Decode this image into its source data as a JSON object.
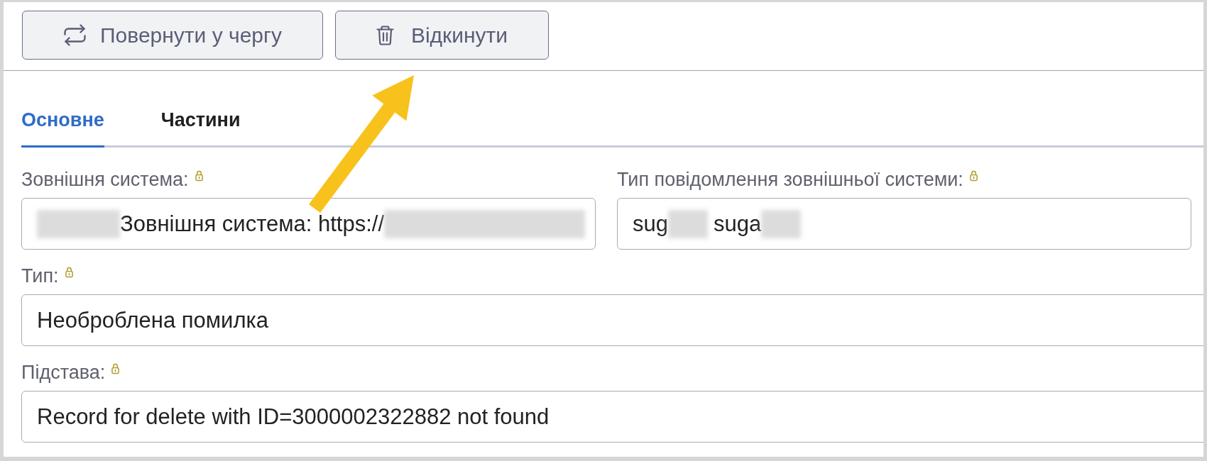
{
  "toolbar": [
    {
      "kind": "requeue",
      "label": "Повернути у чергу"
    },
    {
      "kind": "discard",
      "label": "Відкинути"
    }
  ],
  "tabs": [
    {
      "label": "Основне",
      "selected": true
    },
    {
      "label": "Частини",
      "selected": false
    }
  ],
  "form_rows": [
    [
      {
        "label": "Зовнішня система:",
        "locked": true,
        "value": [
          {
            "kind": "redacted",
            "wide": false
          },
          {
            "kind": "text",
            "text": "Зовнішня система: https://"
          },
          {
            "kind": "redacted",
            "wide": true
          }
        ]
      },
      {
        "label": "Тип повідомлення зовнішньої системи:",
        "locked": true,
        "value": [
          {
            "kind": "text",
            "text": "sug"
          },
          {
            "kind": "redacted",
            "wide": false
          },
          {
            "kind": "text",
            "text": "suga"
          },
          {
            "kind": "redacted",
            "wide": false
          }
        ]
      }
    ],
    [
      {
        "label": "Тип:",
        "locked": true,
        "value": [
          {
            "kind": "text",
            "text": "Необроблена помилка"
          }
        ]
      }
    ],
    [
      {
        "label": "Підстава:",
        "locked": true,
        "value": [
          {
            "kind": "text",
            "text": "Record for delete with ID=3000002322882 not found"
          }
        ]
      }
    ]
  ]
}
